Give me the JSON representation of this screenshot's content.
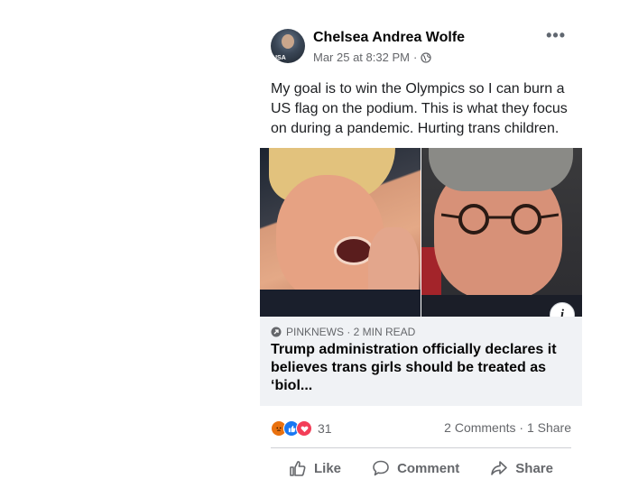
{
  "post": {
    "author": "Chelsea Andrea Wolfe",
    "avatar_badge": "USA",
    "timestamp": "Mar 25 at 8:32 PM",
    "separator": "·",
    "more_label": "•••",
    "text": "My goal is to win the Olympics so I can burn a US flag on the podium. This is what they focus on during a pandemic. Hurting trans children."
  },
  "link": {
    "source": "PINKNEWS · 2 MIN READ",
    "headline": "Trump administration officially declares it believes trans girls should be treated as ‘biol...",
    "info_label": "i"
  },
  "stats": {
    "reaction_count": "31",
    "comments_shares": "2 Comments · 1 Share"
  },
  "actions": {
    "like": "Like",
    "comment": "Comment",
    "share": "Share"
  },
  "colors": {
    "link_bg": "#f0f2f5",
    "like_blue": "#1877f2",
    "love_red": "#f33e58",
    "angry_orange": "#e9710f",
    "secondary_text": "#65676b"
  },
  "icons": [
    "globe-icon",
    "more-icon",
    "info-icon",
    "source-icon",
    "angry-reaction-icon",
    "like-reaction-icon",
    "love-reaction-icon",
    "like-icon",
    "comment-icon",
    "share-icon"
  ]
}
